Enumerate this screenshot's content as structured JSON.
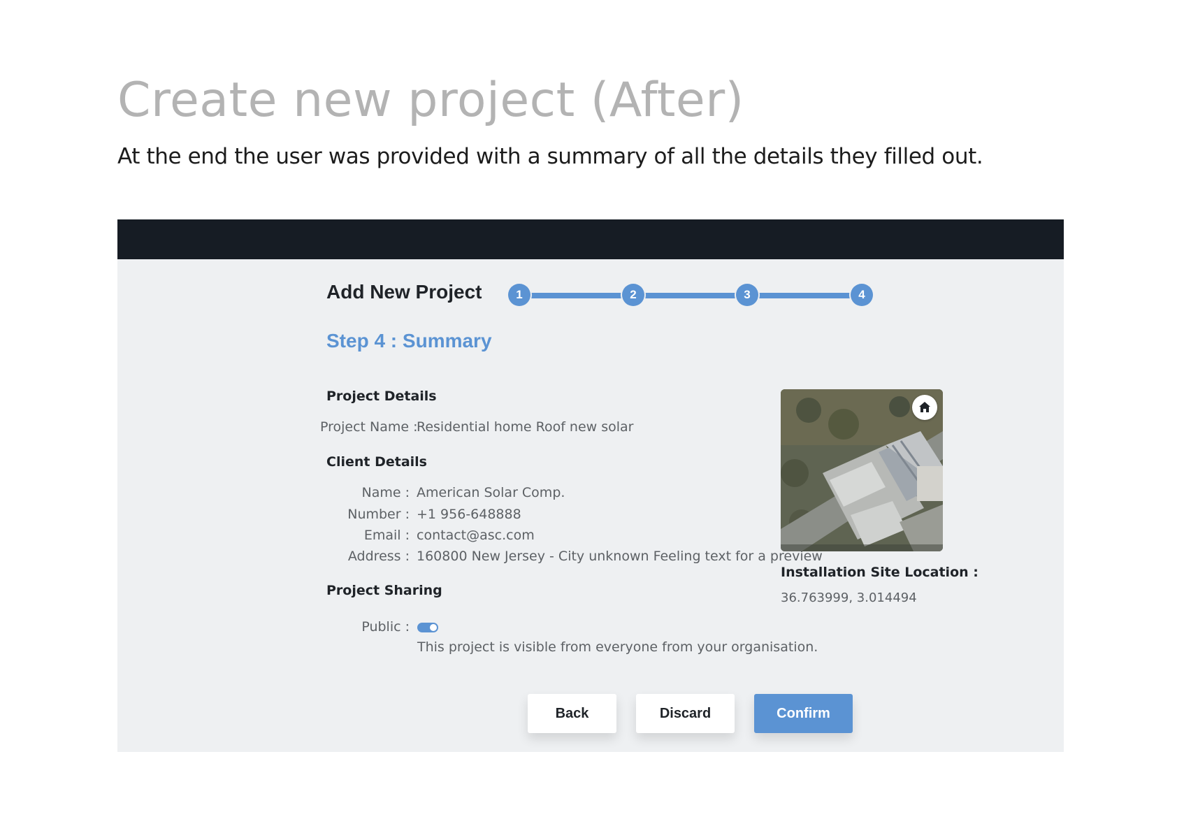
{
  "page": {
    "title": "Create new project (After)",
    "subtitle": "At the end the user was provided with a summary of all the details they filled out."
  },
  "form": {
    "title": "Add New Project",
    "steps": [
      "1",
      "2",
      "3",
      "4"
    ],
    "current_step": 4,
    "step_title": "Step 4 : Summary",
    "project_details": {
      "heading": "Project Details",
      "name_label": "Project Name :",
      "name_value": "Residential home Roof new solar"
    },
    "client_details": {
      "heading": "Client Details",
      "fields": [
        {
          "label": "Name :",
          "value": "American Solar Comp."
        },
        {
          "label": "Number :",
          "value": "+1 956-648888"
        },
        {
          "label": "Email :",
          "value": "contact@asc.com"
        },
        {
          "label": "Address :",
          "value": "160800 New Jersey - City unknown Feeling text for a preview"
        }
      ]
    },
    "sharing": {
      "heading": "Project Sharing",
      "public_label": "Public :",
      "public_enabled": true,
      "note": "This project is visible from everyone from your organisation."
    },
    "location": {
      "heading": "Installation Site Location :",
      "coordinates": "36.763999, 3.014494",
      "map_icon": "home-icon"
    },
    "buttons": {
      "back": "Back",
      "discard": "Discard",
      "confirm": "Confirm"
    }
  },
  "colors": {
    "accent": "#5b93d3",
    "top_bar": "#161c24",
    "panel_bg": "#eef0f2"
  }
}
